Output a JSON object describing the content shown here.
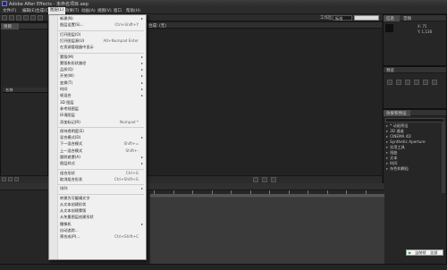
{
  "window": {
    "title": "Adobe After Effects - 未命名项目.aep"
  },
  "menubar": {
    "items": [
      {
        "label": "文件(F)"
      },
      {
        "label": "编辑(E)"
      },
      {
        "label": "合成(C)"
      },
      {
        "label": "图层(L)"
      },
      {
        "label": "效果(T)"
      },
      {
        "label": "动画(A)"
      },
      {
        "label": "视图(V)"
      },
      {
        "label": "窗口"
      },
      {
        "label": "帮助(H)"
      }
    ]
  },
  "toolbar": {
    "workspace_label": "工作区:",
    "workspace_value": "标准"
  },
  "panels": {
    "project_title": "项目",
    "composition_title": "合成: (无)",
    "info_title": "信息",
    "info_sub": "音频",
    "info_lines": [
      "X: 75",
      "Y: 1,138"
    ],
    "effects_title": "效果和预设",
    "preview_title": "预览",
    "timeline_label": "(无)",
    "project_cols": [
      "名称"
    ]
  },
  "layer_menu": {
    "items": [
      {
        "label": "新建(N)",
        "shortcut": "",
        "submenu": true
      },
      {
        "label": "图层设置(S)...",
        "shortcut": "Ctrl+Shift+Y",
        "submenu": false
      },
      {
        "label": "打开图层(O)",
        "shortcut": "",
        "submenu": false,
        "sep_before": true
      },
      {
        "label": "打开图层源(U)",
        "shortcut": "Alt+Numpad Enter",
        "submenu": false
      },
      {
        "label": "在资源管理器中显示",
        "shortcut": "",
        "submenu": false
      },
      {
        "label": "蒙版(M)",
        "shortcut": "",
        "submenu": true,
        "sep_before": true
      },
      {
        "label": "蒙版和形状路径",
        "shortcut": "",
        "submenu": true
      },
      {
        "label": "品质(Q)",
        "shortcut": "",
        "submenu": true
      },
      {
        "label": "开关(W)",
        "shortcut": "",
        "submenu": true
      },
      {
        "label": "变换(T)",
        "shortcut": "",
        "submenu": true
      },
      {
        "label": "时间",
        "shortcut": "",
        "submenu": true
      },
      {
        "label": "帧混合",
        "shortcut": "",
        "submenu": true
      },
      {
        "label": "3D 图层",
        "shortcut": "",
        "submenu": false
      },
      {
        "label": "参考线图层",
        "shortcut": "",
        "submenu": false
      },
      {
        "label": "环境图层",
        "shortcut": "",
        "submenu": false
      },
      {
        "label": "添加标记(R)",
        "shortcut": "Numpad *",
        "submenu": false
      },
      {
        "label": "保持透明度(E)",
        "shortcut": "",
        "submenu": false,
        "sep_before": true
      },
      {
        "label": "混合模式(D)",
        "shortcut": "",
        "submenu": true
      },
      {
        "label": "下一混合模式",
        "shortcut": "Shift+=",
        "submenu": false
      },
      {
        "label": "上一混合模式",
        "shortcut": "Shift+-",
        "submenu": false
      },
      {
        "label": "跟踪遮罩(A)",
        "shortcut": "",
        "submenu": true
      },
      {
        "label": "图层样式",
        "shortcut": "",
        "submenu": true
      },
      {
        "label": "组合形状",
        "shortcut": "Ctrl+G",
        "submenu": false,
        "sep_before": true
      },
      {
        "label": "取消组合形状",
        "shortcut": "Ctrl+Shift+G",
        "submenu": false
      },
      {
        "label": "排列",
        "shortcut": "",
        "submenu": true,
        "sep_before": true
      },
      {
        "label": "转换为可编辑文字",
        "shortcut": "",
        "submenu": false,
        "sep_before": true
      },
      {
        "label": "从文本创建形状",
        "shortcut": "",
        "submenu": false
      },
      {
        "label": "从文本创建蒙版",
        "shortcut": "",
        "submenu": false
      },
      {
        "label": "从矢量图层创建形状",
        "shortcut": "",
        "submenu": false
      },
      {
        "label": "摄像机",
        "shortcut": "",
        "submenu": true
      },
      {
        "label": "自动追踪...",
        "shortcut": "",
        "submenu": false
      },
      {
        "label": "预合成(P)...",
        "shortcut": "Ctrl+Shift+C",
        "submenu": false
      }
    ]
  },
  "effects_list": [
    "* 动画预设",
    "3D 通道",
    "CINEMA 4D",
    "Synthetic Aperture",
    "实用工具",
    "扭曲",
    "文本",
    "时间",
    "杂色和颗粒"
  ],
  "timeline": {
    "ruler_ticks": 12
  },
  "preview_button": {
    "label": "当前帧",
    "label2": "全部"
  },
  "colors": {
    "menu_bg": "#f0f0f0",
    "app_bg": "#1e1e1e",
    "active_menu": "#e8e8e8"
  }
}
